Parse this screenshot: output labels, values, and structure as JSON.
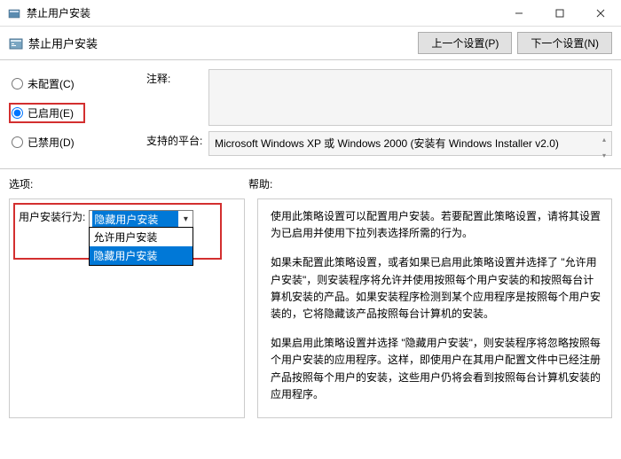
{
  "titlebar": {
    "icon": "policy-icon",
    "title": "禁止用户安装"
  },
  "subheader": {
    "title": "禁止用户安装",
    "prev_button": "上一个设置(P)",
    "next_button": "下一个设置(N)"
  },
  "radios": {
    "not_configured": "未配置(C)",
    "enabled": "已启用(E)",
    "disabled": "已禁用(D)"
  },
  "fields": {
    "comment_label": "注释:",
    "comment_value": "",
    "platform_label": "支持的平台:",
    "platform_value": "Microsoft Windows XP 或 Windows 2000 (安装有 Windows Installer v2.0)"
  },
  "labels": {
    "options": "选项:",
    "help": "帮助:"
  },
  "options": {
    "behavior_label": "用户安装行为:",
    "selected": "隐藏用户安装",
    "items": [
      "允许用户安装",
      "隐藏用户安装"
    ]
  },
  "help": {
    "p1": "使用此策略设置可以配置用户安装。若要配置此策略设置，请将其设置为已启用并使用下拉列表选择所需的行为。",
    "p2": "如果未配置此策略设置，或者如果已启用此策略设置并选择了 \"允许用户安装\"，则安装程序将允许并使用按照每个用户安装的和按照每台计算机安装的产品。如果安装程序检测到某个应用程序是按照每个用户安装的，它将隐藏该产品按照每台计算机的安装。",
    "p3": "如果启用此策略设置并选择 \"隐藏用户安装\"，则安装程序将忽略按照每个用户安装的应用程序。这样，即使用户在其用户配置文件中已经注册产品按照每个用户的安装，这些用户仍将会看到按照每台计算机安装的应用程序。"
  }
}
